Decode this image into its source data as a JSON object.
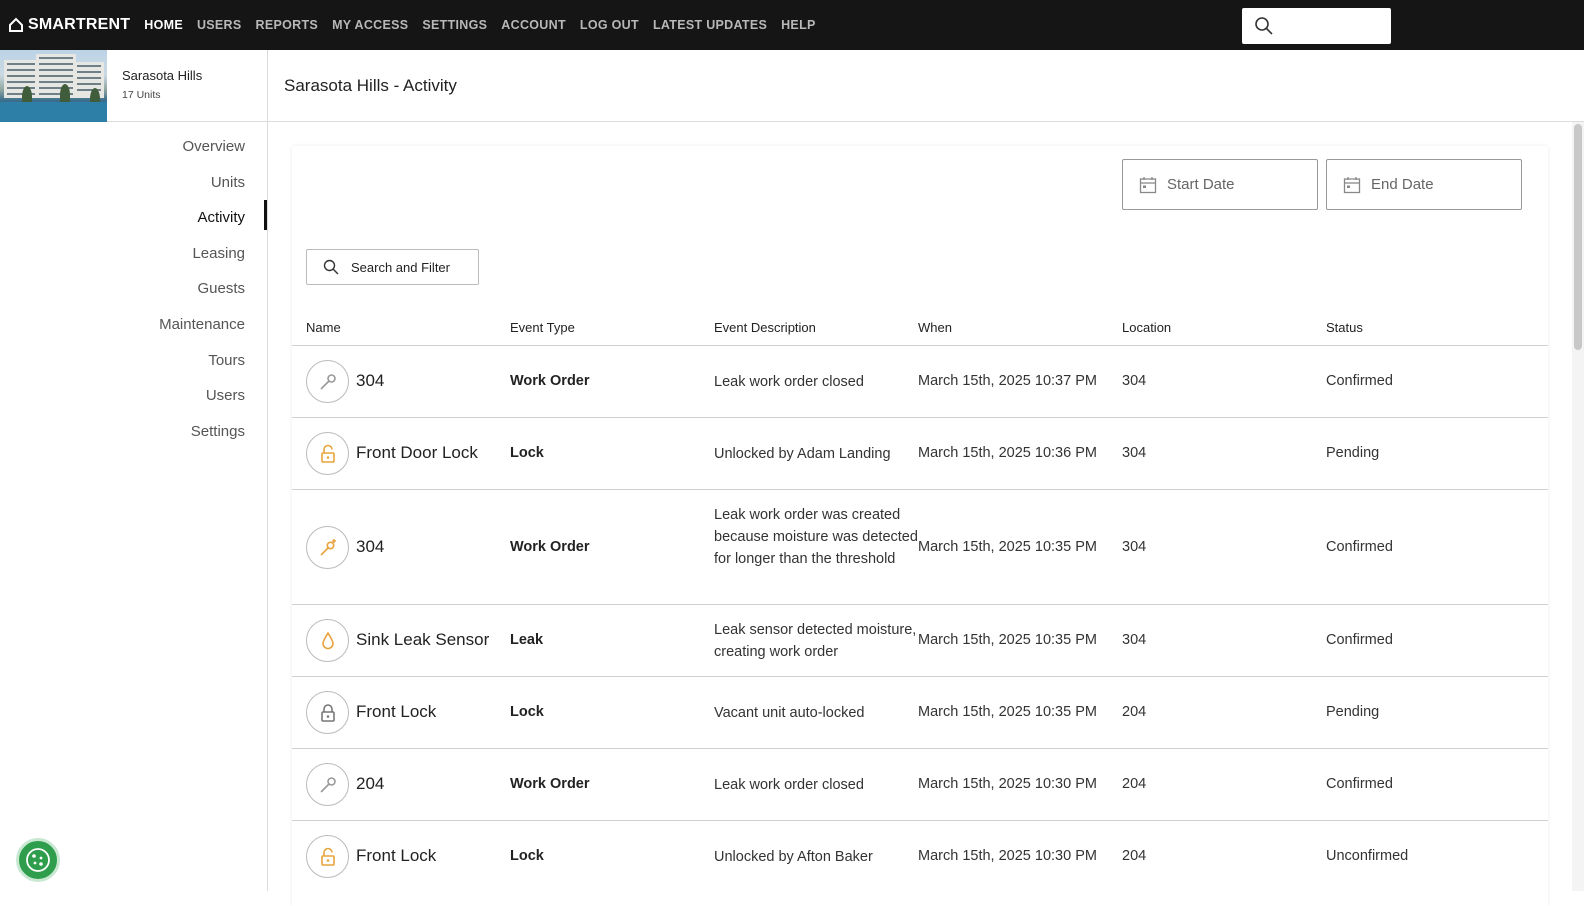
{
  "brand": {
    "name": "SMARTRENT"
  },
  "nav": [
    {
      "label": "HOME",
      "active": true
    },
    {
      "label": "USERS",
      "active": false
    },
    {
      "label": "REPORTS",
      "active": false
    },
    {
      "label": "MY ACCESS",
      "active": false
    },
    {
      "label": "SETTINGS",
      "active": false
    },
    {
      "label": "ACCOUNT",
      "active": false
    },
    {
      "label": "LOG OUT",
      "active": false
    },
    {
      "label": "LATEST UPDATES",
      "active": false
    },
    {
      "label": "HELP",
      "active": false
    }
  ],
  "search": {
    "placeholder": ""
  },
  "property": {
    "name": "Sarasota Hills",
    "units": "17 Units"
  },
  "sidebar": {
    "items": [
      {
        "label": "Overview",
        "active": false
      },
      {
        "label": "Units",
        "active": false
      },
      {
        "label": "Activity",
        "active": true
      },
      {
        "label": "Leasing",
        "active": false
      },
      {
        "label": "Guests",
        "active": false
      },
      {
        "label": "Maintenance",
        "active": false
      },
      {
        "label": "Tours",
        "active": false
      },
      {
        "label": "Users",
        "active": false
      },
      {
        "label": "Settings",
        "active": false
      }
    ]
  },
  "page": {
    "title": "Sarasota Hills - Activity"
  },
  "filters": {
    "start_date": "Start Date",
    "end_date": "End Date",
    "search_filter": "Search and Filter"
  },
  "table": {
    "columns": [
      "Name",
      "Event Type",
      "Event Description",
      "When",
      "Location",
      "Status"
    ],
    "rows": [
      {
        "icon": "wrench-icon",
        "name": "304",
        "type": "Work Order",
        "desc": "Leak work order closed",
        "when": "March 15th, 2025 10:37 PM",
        "location": "304",
        "status": "Confirmed"
      },
      {
        "icon": "lock-open-icon",
        "name": "Front Door Lock",
        "type": "Lock",
        "desc": "Unlocked by Adam Landing",
        "when": "March 15th, 2025 10:36 PM",
        "location": "304",
        "status": "Pending"
      },
      {
        "icon": "wrench-plus-icon",
        "name": "304",
        "type": "Work Order",
        "desc": "Leak work order was created because moisture was detected for longer than the threshold",
        "when": "March 15th, 2025 10:35 PM",
        "location": "304",
        "status": "Confirmed"
      },
      {
        "icon": "drop-icon",
        "name": "Sink Leak Sensor",
        "type": "Leak",
        "desc": "Leak sensor detected moisture, creating work order",
        "when": "March 15th, 2025 10:35 PM",
        "location": "304",
        "status": "Confirmed"
      },
      {
        "icon": "lock-closed-icon",
        "name": "Front Lock",
        "type": "Lock",
        "desc": "Vacant unit auto-locked",
        "when": "March 15th, 2025 10:35 PM",
        "location": "204",
        "status": "Pending"
      },
      {
        "icon": "wrench-icon",
        "name": "204",
        "type": "Work Order",
        "desc": "Leak work order closed",
        "when": "March 15th, 2025 10:30 PM",
        "location": "204",
        "status": "Confirmed"
      },
      {
        "icon": "lock-open-icon",
        "name": "Front Lock",
        "type": "Lock",
        "desc": "Unlocked by Afton Baker",
        "when": "March 15th, 2025 10:30 PM",
        "location": "204",
        "status": "Unconfirmed"
      }
    ]
  },
  "colors": {
    "accent": "#e8a33c",
    "topbar": "#151515",
    "cookie": "#2e9e4d"
  }
}
